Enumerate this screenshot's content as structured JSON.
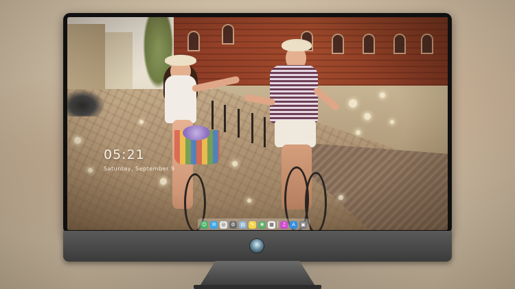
{
  "lock_screen": {
    "time": "05:21",
    "date": "Saturday, September 9"
  },
  "dock": {
    "items": [
      {
        "name": "finder",
        "color": "#49b26a",
        "glyph": "☺"
      },
      {
        "name": "messages",
        "color": "#3aa7e8",
        "glyph": "✉"
      },
      {
        "name": "safari",
        "color": "#e6e6e6",
        "glyph": "◎"
      },
      {
        "name": "system-preferences",
        "color": "#6d6d6d",
        "glyph": "⚙"
      },
      {
        "name": "preview",
        "color": "#8fb4cf",
        "glyph": "▤"
      },
      {
        "name": "notes",
        "color": "#f5d64b",
        "glyph": "✎"
      },
      {
        "name": "photos",
        "color": "#5fae6b",
        "glyph": "❀"
      },
      {
        "name": "calendar",
        "color": "#f4f4f4",
        "glyph": "▦"
      },
      {
        "name": "itunes",
        "color": "#d24ad1",
        "glyph": "♫"
      },
      {
        "name": "app-store",
        "color": "#2f8fe6",
        "glyph": "A"
      },
      {
        "name": "trash",
        "color": "#7d7d7d",
        "glyph": "▣"
      }
    ]
  },
  "colors": {
    "bezel": "#101010",
    "chin": "#4a4a4a",
    "accent_logo": "#6a8fa3"
  }
}
